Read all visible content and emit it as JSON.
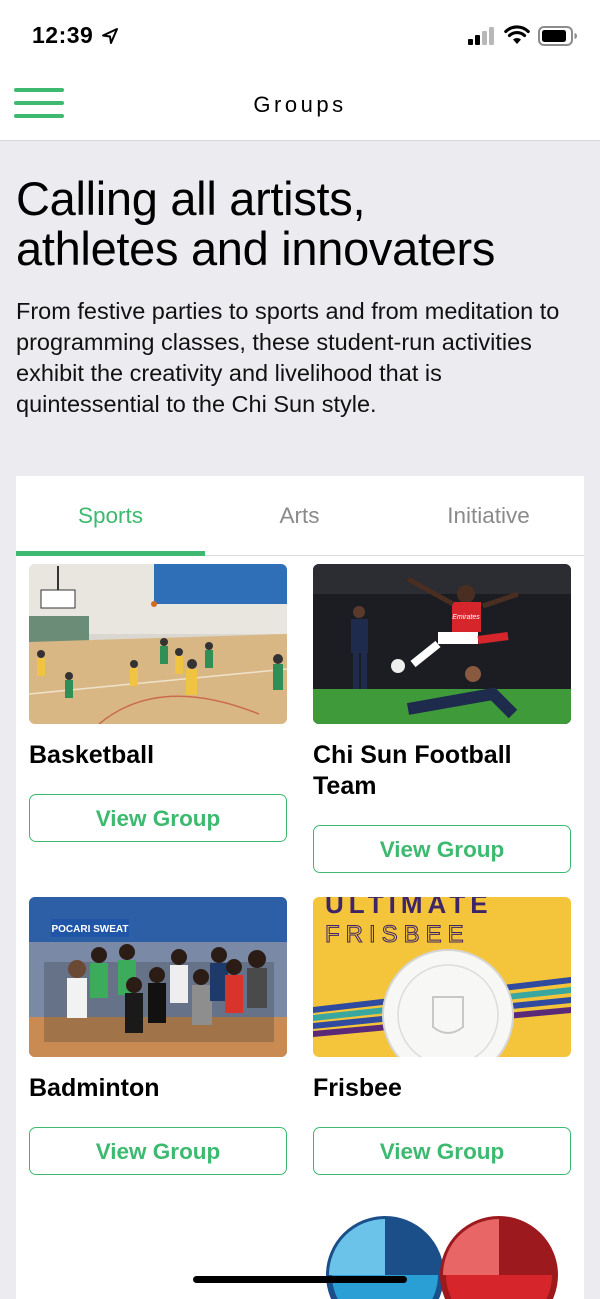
{
  "status": {
    "time": "12:39"
  },
  "nav": {
    "title": "Groups"
  },
  "hero": {
    "title_line1": "Calling all artists,",
    "title_line2": "athletes and innovaters",
    "description": "From festive parties to sports and from meditation to programming classes, these student-run activities exhibit the creativity and livelihood that is quintessential to the Chi Sun style."
  },
  "tabs": [
    {
      "label": "Sports",
      "active": true
    },
    {
      "label": "Arts",
      "active": false
    },
    {
      "label": "Initiative",
      "active": false
    }
  ],
  "groups": [
    {
      "title": "Basketball",
      "button": "View Group",
      "image": "basketball-photo"
    },
    {
      "title": "Chi Sun Football Team",
      "button": "View Group",
      "image": "football-photo"
    },
    {
      "title": "Badminton",
      "button": "View Group",
      "image": "badminton-photo"
    },
    {
      "title": "Frisbee",
      "button": "View Group",
      "image": "frisbee-poster"
    },
    {
      "title": "",
      "button": "",
      "image": "table-tennis-logo"
    }
  ],
  "image_text": {
    "sponsor_banner": "POCARI SWEAT",
    "frisbee_line1": "ULTIMATE",
    "frisbee_line2": "FRISBEE",
    "jersey_sponsor": "Emirates"
  },
  "colors": {
    "accent": "#3dba6f",
    "page_bg": "#ececf0"
  }
}
